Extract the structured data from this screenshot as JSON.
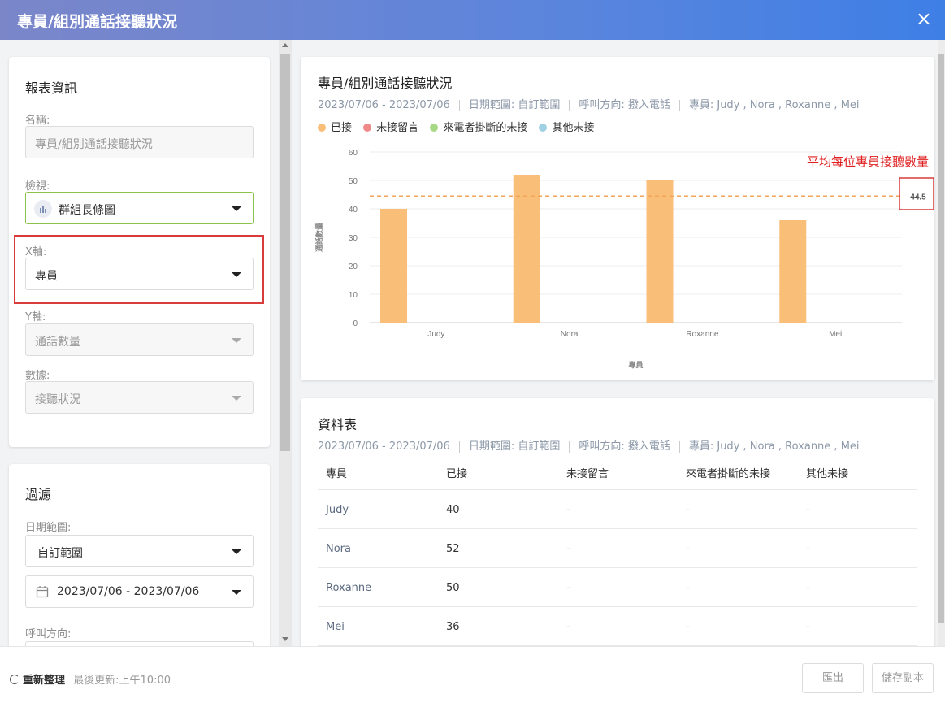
{
  "window": {
    "title": "專員/組別通話接聽狀況",
    "close_icon": "×"
  },
  "report_info": {
    "section_title": "報表資訊",
    "name_label": "名稱:",
    "name_value": "專員/組別通話接聽狀況",
    "view_label": "檢視:",
    "view_value": "群組長條圖",
    "x_axis_label": "X軸:",
    "x_axis_value": "專員",
    "y_axis_label": "Y軸:",
    "y_axis_value": "通話數量",
    "data_label": "數據:",
    "data_value": "接聽狀況"
  },
  "filter": {
    "section_title": "過濾",
    "date_range_label": "日期範圍:",
    "date_range_value": "自訂範圍",
    "date_value": "2023/07/06 - 2023/07/06",
    "direction_label": "呼叫方向:"
  },
  "chart_card": {
    "title": "專員/組別通話接聽狀況",
    "meta": [
      "2023/07/06 - 2023/07/06",
      "日期範圍: 自訂範圍",
      "呼叫方向: 撥入電話",
      "專員: Judy , Nora , Roxanne , Mei"
    ],
    "annotation": "平均每位專員接聽數量",
    "avg_label": "44.5"
  },
  "chart_data": {
    "type": "bar",
    "categories": [
      "Judy",
      "Nora",
      "Roxanne",
      "Mei"
    ],
    "series": [
      {
        "name": "已接",
        "values": [
          40,
          52,
          50,
          36
        ],
        "color": "#f9be78"
      },
      {
        "name": "未接留言",
        "values": [
          0,
          0,
          0,
          0
        ],
        "color": "#f08a8a"
      },
      {
        "name": "來電者掛斷的未接",
        "values": [
          0,
          0,
          0,
          0
        ],
        "color": "#a7d886"
      },
      {
        "name": "其他未接",
        "values": [
          0,
          0,
          0,
          0
        ],
        "color": "#9fd0e3"
      }
    ],
    "xlabel": "專員",
    "ylabel": "通話數量",
    "ylim": [
      0,
      60
    ],
    "yticks": [
      "0",
      "10",
      "20",
      "30",
      "40",
      "50",
      "60"
    ],
    "average": 44.5,
    "grid": true,
    "legend_position": "top-left"
  },
  "table_card": {
    "title": "資料表",
    "meta": [
      "2023/07/06 - 2023/07/06",
      "日期範圍: 自訂範圍",
      "呼叫方向: 撥入電話",
      "專員: Judy , Nora , Roxanne , Mei"
    ],
    "columns": [
      "專員",
      "已接",
      "未接留言",
      "來電者掛斷的未接",
      "其他未接"
    ],
    "rows": [
      [
        "Judy",
        "40",
        "-",
        "-",
        "-"
      ],
      [
        "Nora",
        "52",
        "-",
        "-",
        "-"
      ],
      [
        "Roxanne",
        "50",
        "-",
        "-",
        "-"
      ],
      [
        "Mei",
        "36",
        "-",
        "-",
        "-"
      ]
    ]
  },
  "footer": {
    "refresh_label": "重新整理",
    "last_update": "最後更新:上午10:00",
    "export_label": "匯出",
    "save_copy_label": "儲存副本"
  }
}
